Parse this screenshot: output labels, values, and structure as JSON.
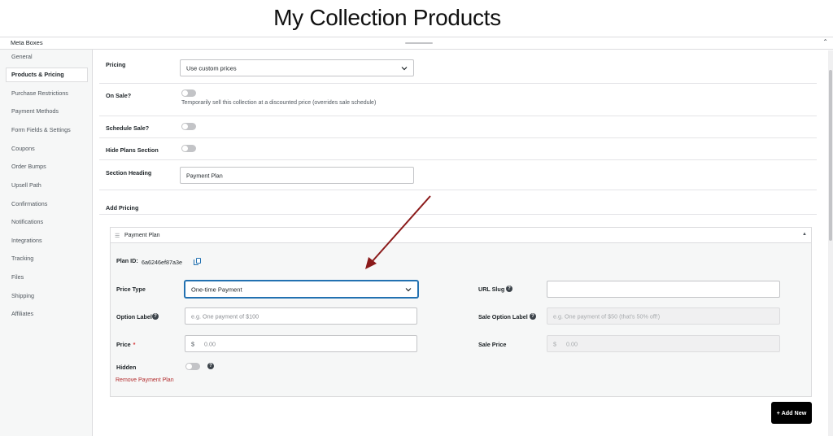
{
  "page": {
    "title": "My Collection Products"
  },
  "metabox": {
    "title": "Meta Boxes"
  },
  "sidebar": {
    "items": [
      {
        "label": "General"
      },
      {
        "label": "Products & Pricing"
      },
      {
        "label": "Purchase Restrictions"
      },
      {
        "label": "Payment Methods"
      },
      {
        "label": "Form Fields & Settings"
      },
      {
        "label": "Coupons"
      },
      {
        "label": "Order Bumps"
      },
      {
        "label": "Upsell Path"
      },
      {
        "label": "Confirmations"
      },
      {
        "label": "Notifications"
      },
      {
        "label": "Integrations"
      },
      {
        "label": "Tracking"
      },
      {
        "label": "Files"
      },
      {
        "label": "Shipping"
      },
      {
        "label": "Affiliates"
      }
    ],
    "active_index": 1
  },
  "settings": {
    "pricing": {
      "label": "Pricing",
      "value": "Use custom prices"
    },
    "on_sale": {
      "label": "On Sale?",
      "help": "Temporarily sell this collection at a discounted price (overrides sale schedule)",
      "enabled": false
    },
    "schedule_sale": {
      "label": "Schedule Sale?",
      "enabled": false
    },
    "hide_plans": {
      "label": "Hide Plans Section",
      "enabled": false
    },
    "section_heading": {
      "label": "Section Heading",
      "value": "Payment Plan"
    },
    "add_pricing": {
      "label": "Add Pricing"
    }
  },
  "plan": {
    "title": "Payment Plan",
    "plan_id_label": "Plan ID:",
    "plan_id": "6a6246ef87a3e",
    "price_type": {
      "label": "Price Type",
      "value": "One-time Payment"
    },
    "option_label": {
      "label": "Option Label",
      "placeholder": "e.g. One payment of $100"
    },
    "price": {
      "label": "Price",
      "required": "*",
      "currency": "$",
      "placeholder": "0.00"
    },
    "hidden": {
      "label": "Hidden",
      "enabled": false
    },
    "url_slug": {
      "label": "URL Slug",
      "value": ""
    },
    "sale_option_label": {
      "label": "Sale Option Label",
      "placeholder": "e.g. One payment of $50 (that's 50% off!)"
    },
    "sale_price": {
      "label": "Sale Price",
      "currency": "$",
      "placeholder": "0.00"
    },
    "remove_label": "Remove Payment Plan"
  },
  "actions": {
    "add_new": "+ Add New"
  },
  "colors": {
    "accent": "#2271b1",
    "danger": "#b32d2e",
    "annotation_arrow": "#8b1a1a",
    "button_bg": "#000000"
  },
  "icons": {
    "help": "question-circle-icon",
    "copy": "copy-icon",
    "chevron": "chevron-down-icon",
    "drag": "menu-icon",
    "collapse": "caret-up-icon"
  }
}
